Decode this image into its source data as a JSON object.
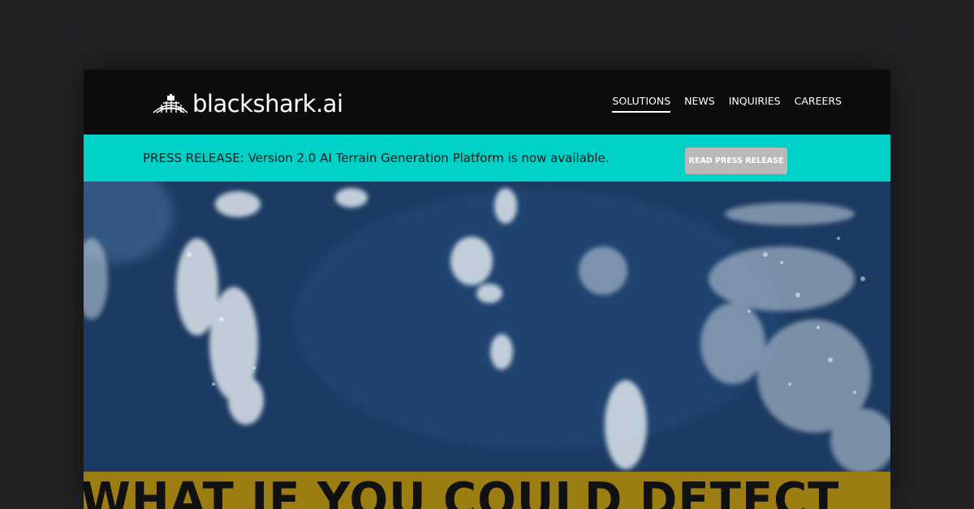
{
  "header": {
    "logo_text": "blackshark",
    "logo_suffix": ".ai",
    "logo_icon": "globe-grid-icon",
    "nav": [
      {
        "label": "SOLUTIONS",
        "active": true
      },
      {
        "label": "NEWS",
        "active": false
      },
      {
        "label": "INQUIRIES",
        "active": false
      },
      {
        "label": "CAREERS",
        "active": false
      }
    ]
  },
  "banner": {
    "text": "PRESS RELEASE: Version 2.0 AI Terrain Generation Platform is now available.",
    "button_label": "READ PRESS RELEASE",
    "background_color": "#00d1c6",
    "button_color": "#b9b9b9"
  },
  "hero": {
    "image_description_icon": "satellite-earth-image",
    "headline": "WHAT IF YOU COULD DETECT",
    "headline_band_color": "#9c7d12"
  }
}
